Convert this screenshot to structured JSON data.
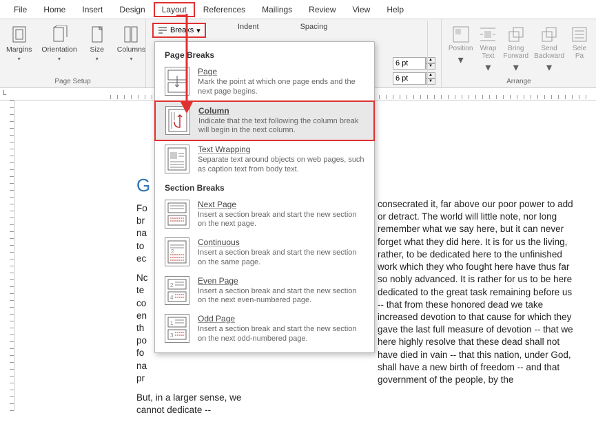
{
  "menubar": {
    "items": [
      "File",
      "Home",
      "Insert",
      "Design",
      "Layout",
      "References",
      "Mailings",
      "Review",
      "View",
      "Help"
    ],
    "highlighted": "Layout"
  },
  "ribbon": {
    "page_setup": {
      "label": "Page Setup",
      "margins": "Margins",
      "orientation": "Orientation",
      "size": "Size",
      "columns": "Columns"
    },
    "breaks_btn": "Breaks",
    "indent_label": "Indent",
    "spacing_label": "Spacing",
    "spacing_before": "6 pt",
    "spacing_after": "6 pt",
    "arrange": {
      "label": "Arrange",
      "position": "Position",
      "wrap_text": "Wrap\nText",
      "bring_forward": "Bring\nForward",
      "send_backward": "Send\nBackward",
      "selection": "Sele\nPa"
    }
  },
  "dropdown": {
    "page_breaks_title": "Page Breaks",
    "section_breaks_title": "Section Breaks",
    "items": {
      "page": {
        "label": "Page",
        "desc": "Mark the point at which one page ends and the next page begins."
      },
      "column": {
        "label": "Column",
        "desc": "Indicate that the text following the column break will begin in the next column."
      },
      "text_wrapping": {
        "label": "Text Wrapping",
        "desc": "Separate text around objects on web pages, such as caption text from body text."
      },
      "next_page": {
        "label": "Next Page",
        "desc": "Insert a section break and start the new section on the next page."
      },
      "continuous": {
        "label": "Continuous",
        "desc": "Insert a section break and start the new section on the same page."
      },
      "even_page": {
        "label": "Even Page",
        "desc": "Insert a section break and start the new section on the next even-numbered page."
      },
      "odd_page": {
        "label": "Odd Page",
        "desc": "Insert a section break and start the new section on the next odd-numbered page."
      }
    }
  },
  "document": {
    "heading_first_letter": "G",
    "col_left_p1": "Fo\nbr\nna\nto\nec",
    "col_left_p2": "Nc\nte\nco\nen\nth\npo\nfo\nna\npr",
    "col_left_p3": "But, in a larger sense, we cannot dedicate --",
    "col_right": "consecrated it, far above our poor power to add or detract. The world will little note, nor long remember what we say here, but it can never forget what they did here. It is for us the living, rather, to be dedicated here to the unfinished work which they who fought here have thus far so nobly advanced. It is rather for us to be here dedicated to the great task remaining before us -- that from these honored dead we take increased devotion to that cause for which they gave the last full measure of devotion -- that we here highly resolve that these dead shall not have died in vain -- that this nation, under God, shall have a new birth of freedom -- and that government of the people, by the"
  },
  "ruler_letter": "L"
}
